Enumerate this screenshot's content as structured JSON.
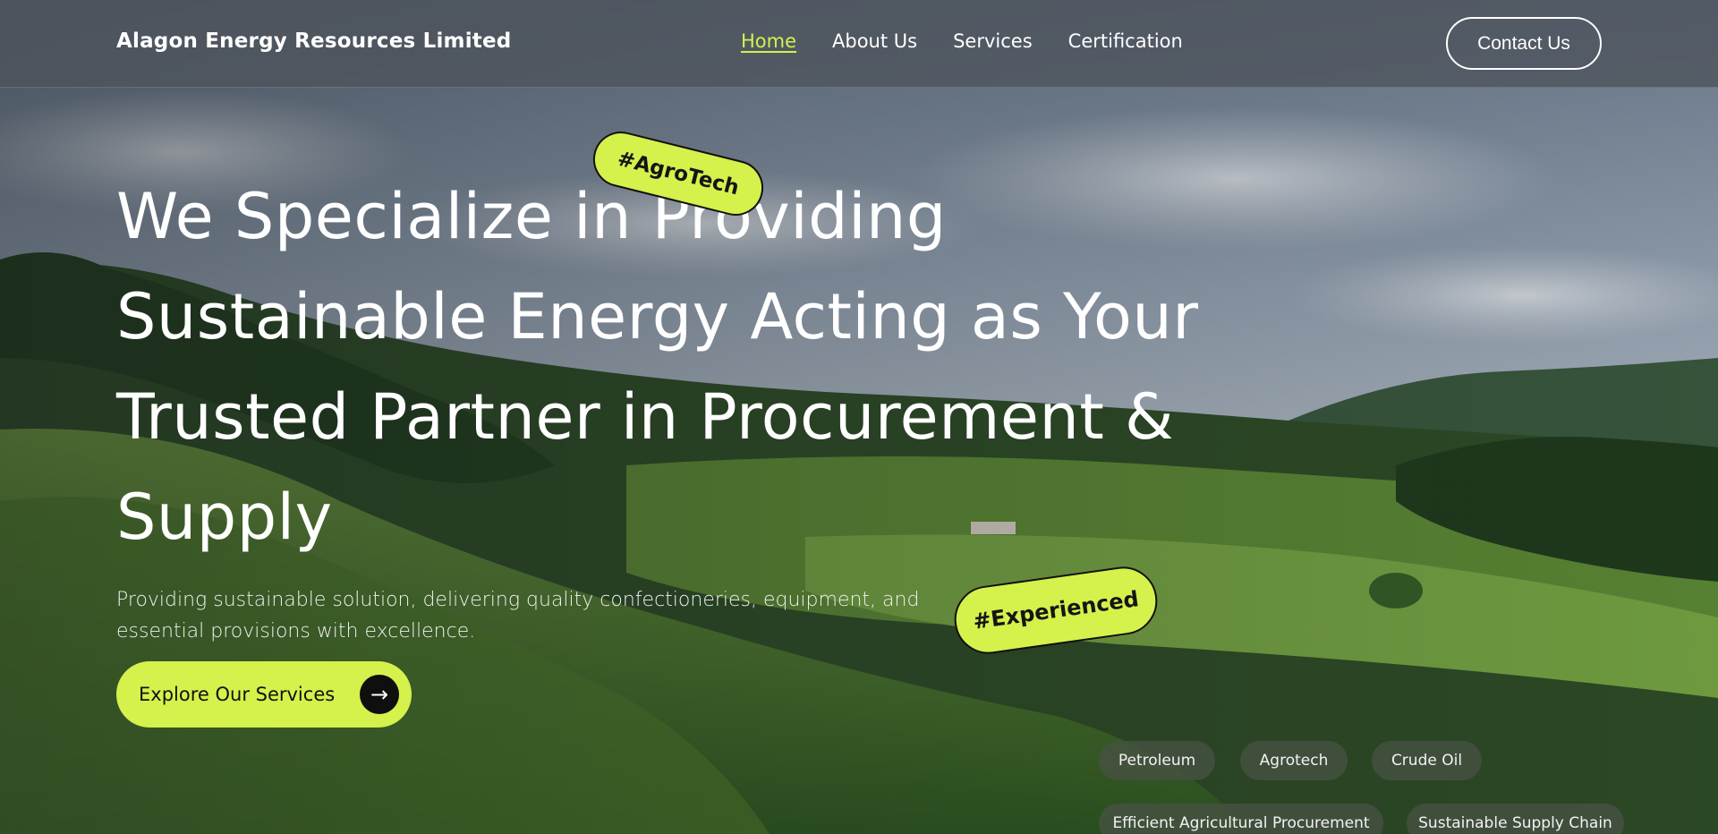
{
  "brand": {
    "name": "Alagon Energy Resources Limited"
  },
  "nav": {
    "items": [
      {
        "label": "Home",
        "active": true
      },
      {
        "label": "About Us",
        "active": false
      },
      {
        "label": "Services",
        "active": false
      },
      {
        "label": "Certification",
        "active": false
      }
    ],
    "contact_label": "Contact Us"
  },
  "hero": {
    "headline": "We Specialize in Providing Sustainable Energy Acting as Your Trusted Partner in Procurement & Supply",
    "subline": "Providing sustainable solution, delivering quality confectioneries, equipment, and essential provisions with excellence.",
    "cta_label": "Explore Our Services",
    "cta_icon": "arrow-right-icon"
  },
  "tags": [
    "#AgroTech",
    "#Experienced"
  ],
  "pills": [
    "Petroleum",
    "Agrotech",
    "Crude Oil",
    "Efficient Agricultural Procurement",
    "Sustainable Supply Chain"
  ],
  "colors": {
    "accent": "#d4f14c",
    "nav_active": "#d6f14e",
    "header_bg": "#4e545c"
  }
}
